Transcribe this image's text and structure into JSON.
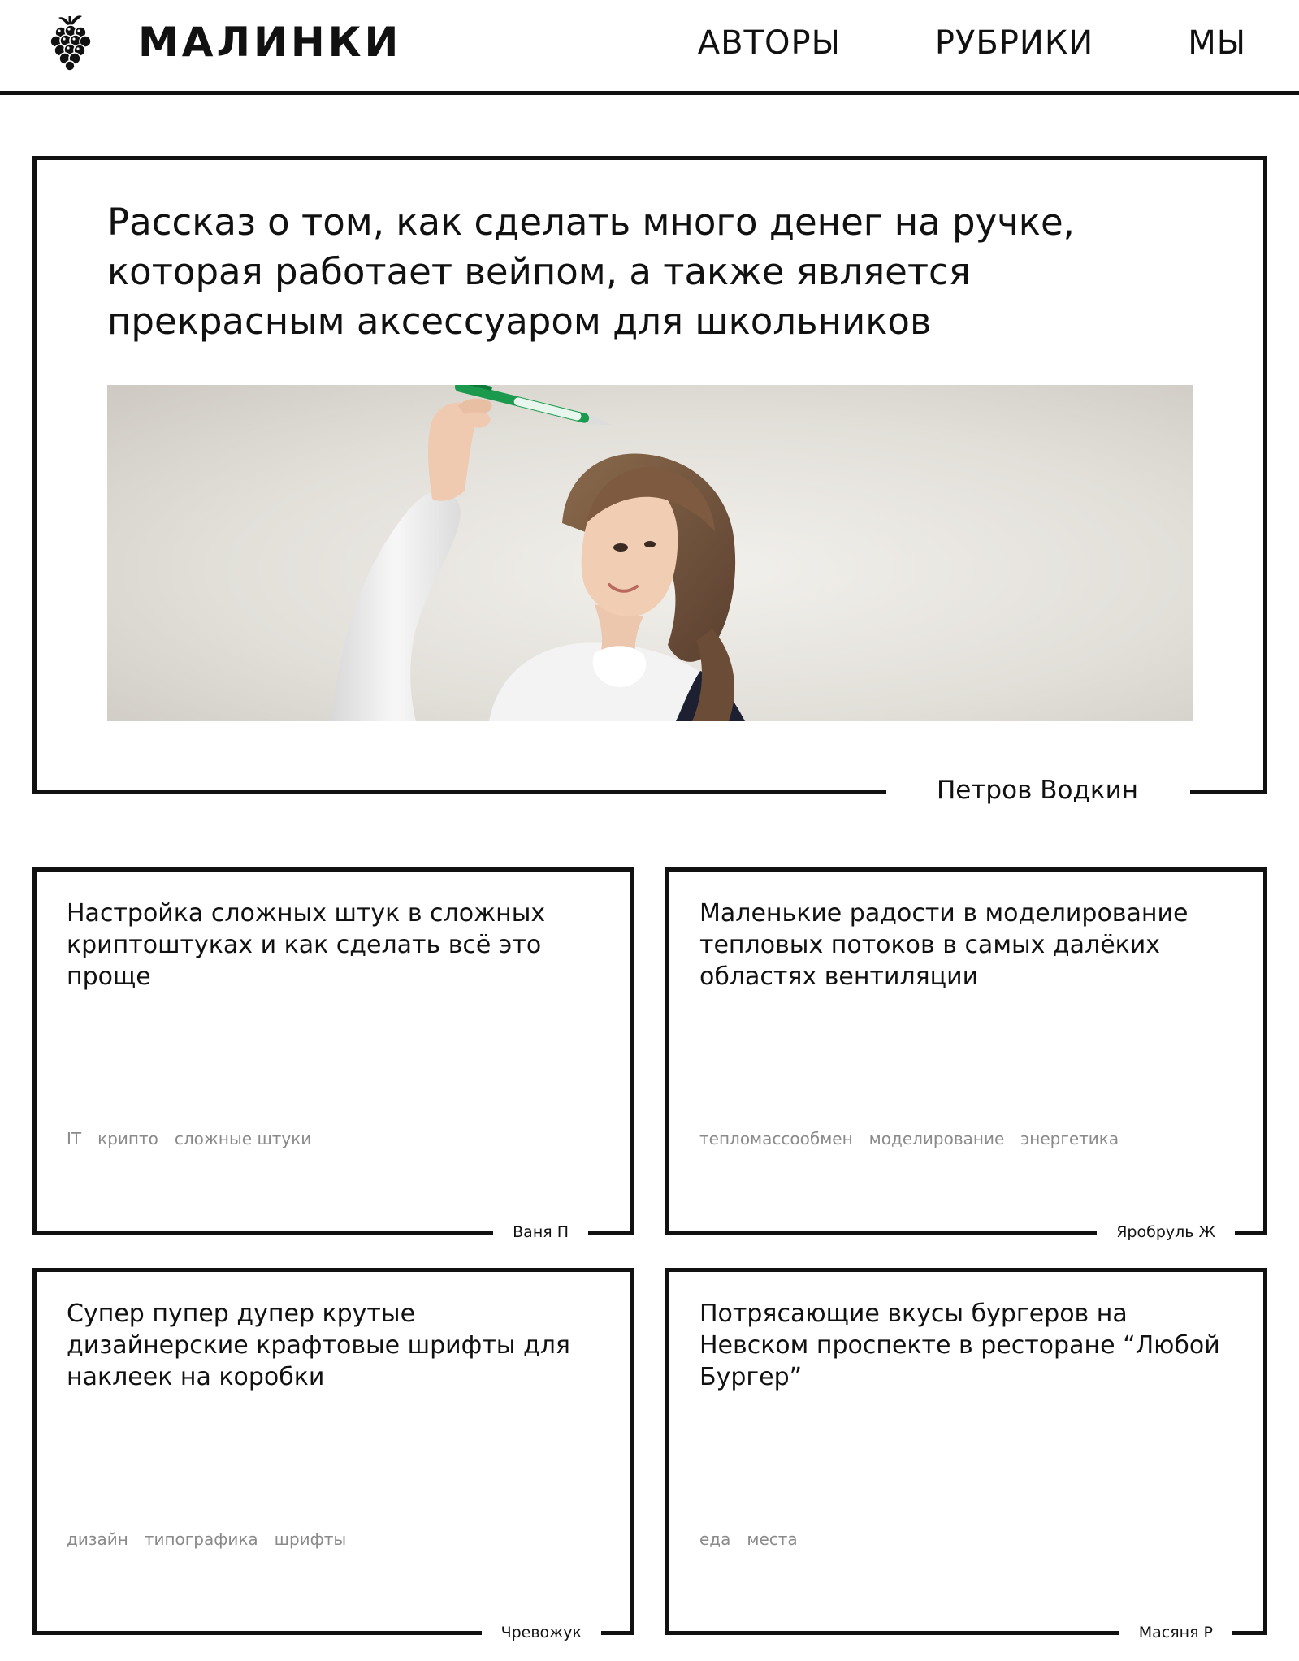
{
  "header": {
    "logo_text": "МАЛИНКИ",
    "logo_icon": "raspberry-icon",
    "nav": [
      "АВТОРЫ",
      "РУБРИКИ",
      "МЫ"
    ]
  },
  "hero": {
    "title": "Рассказ о том, как сделать много денег на ручке, которая работает вейпом, а также является прекрасным аксессуаром для школьников",
    "image": "photo of a girl holding a green pen",
    "author": "Петров Водкин"
  },
  "cards": [
    {
      "title": "Настройка сложных штук в сложных криптоштуках и как сделать всё это проще",
      "tags": [
        "IT",
        "крипто",
        "сложные штуки"
      ],
      "author": "Ваня П"
    },
    {
      "title": "Маленькие радости в моделирование тепловых потоков в самых далёких областях вентиляции",
      "tags": [
        "тепломассообмен",
        "моделирование",
        "энергетика"
      ],
      "author": "Яробруль Ж"
    },
    {
      "title": "Супер пупер дупер крутые дизайнерские крафтовые шрифты для наклеек на коробки",
      "tags": [
        "дизайн",
        "типографика",
        "шрифты"
      ],
      "author": "Чревожук"
    },
    {
      "title": "Потрясающие вкусы бургеров на Невском проспекте в ресторане “Любой Бургер”",
      "tags": [
        "еда",
        "места"
      ],
      "author": "Масяня Р"
    }
  ],
  "colors": {
    "text": "#111111",
    "tag": "#8a8a8a",
    "background": "#ffffff",
    "border": "#111111"
  }
}
